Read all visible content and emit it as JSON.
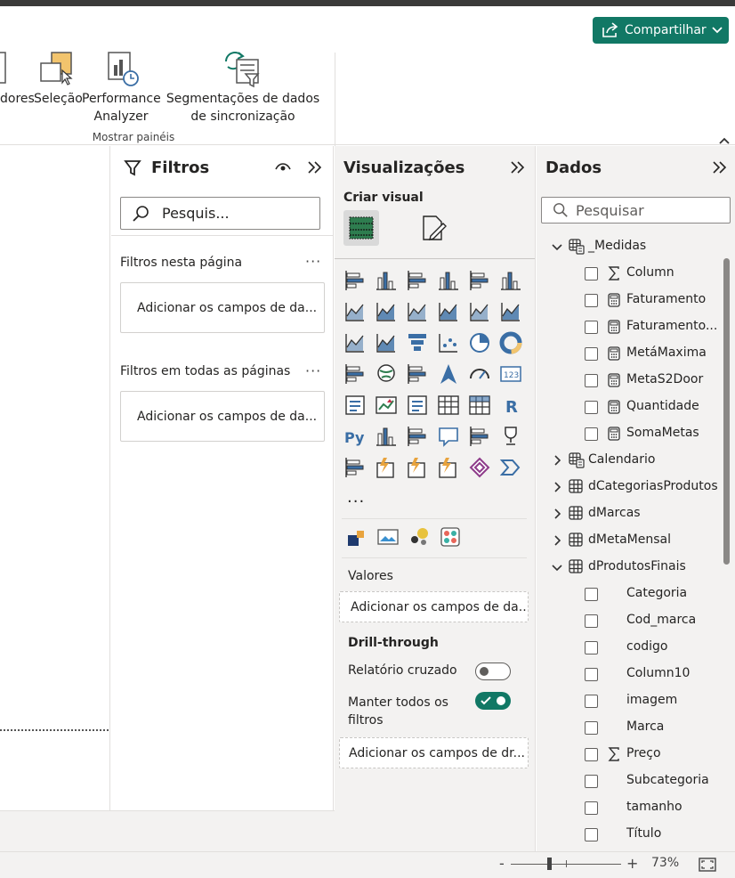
{
  "ribbon": {
    "share_label": "Compartilhar",
    "buttons": [
      {
        "label": "dores"
      },
      {
        "label": "Seleção"
      },
      {
        "label": "Performance Analyzer"
      },
      {
        "label": "Segmentações de dados de sincronização"
      }
    ],
    "group_label": "Mostrar painéis"
  },
  "filters": {
    "title": "Filtros",
    "search_placeholder": "Pesquis...",
    "page_section": "Filtros nesta página",
    "page_well": "Adicionar os campos de da...",
    "all_section": "Filtros em todas as páginas",
    "all_well": "Adicionar os campos de da..."
  },
  "viz": {
    "title": "Visualizações",
    "subtitle": "Criar visual",
    "more": "...",
    "values_label": "Valores",
    "values_well": "Adicionar os campos de da...",
    "drill_label": "Drill-through",
    "cross_report_label": "Relatório cruzado",
    "cross_report_on": false,
    "keep_filters_label_1": "Manter todos os",
    "keep_filters_label_2": "filtros",
    "keep_filters_on": true,
    "drill_well": "Adicionar os campos de dr...",
    "icons": [
      "stacked-bar-icon",
      "stacked-column-icon",
      "clustered-bar-icon",
      "clustered-column-icon",
      "100-stacked-bar-icon",
      "100-stacked-column-icon",
      "line-chart-icon",
      "area-chart-icon",
      "stacked-area-icon",
      "100-stacked-area-icon",
      "line-clustered-column-icon",
      "line-stacked-column-icon",
      "ribbon-chart-icon",
      "waterfall-icon",
      "funnel-icon",
      "scatter-icon",
      "pie-icon",
      "donut-icon",
      "treemap-icon",
      "map-icon",
      "filled-map-icon",
      "azure-map-icon",
      "gauge-icon",
      "card-icon",
      "multi-row-card-icon",
      "kpi-icon",
      "slicer-icon",
      "table-icon",
      "matrix-icon",
      "r-script-icon",
      "python-icon",
      "key-influencers-icon",
      "decomposition-tree-icon",
      "qa-icon",
      "narrative-icon",
      "goals-icon",
      "paginated-report-icon",
      "power-apps-icon",
      "power-automate-icon",
      "arcgis-icon",
      "shape-map-icon",
      "power-bi-app-icon"
    ],
    "extra_icons": [
      "custom-visual-icon",
      "image-visual-icon",
      "bubble-visual-icon",
      "palette-visual-icon"
    ]
  },
  "data_pane": {
    "title": "Dados",
    "search_placeholder": "Pesquisar",
    "tables": [
      {
        "name": "_Medidas",
        "expanded": true,
        "icon": "calc-table-icon",
        "fields": [
          {
            "name": "Column",
            "kind": "sigma"
          },
          {
            "name": "Faturamento",
            "kind": "calc"
          },
          {
            "name": "Faturamento...",
            "kind": "calc"
          },
          {
            "name": "MetáMaxima",
            "kind": "calc"
          },
          {
            "name": "MetaS2Door",
            "kind": "calc"
          },
          {
            "name": "Quantidade",
            "kind": "calc"
          },
          {
            "name": "SomaMetas",
            "kind": "calc"
          }
        ]
      },
      {
        "name": "Calendario",
        "expanded": false,
        "icon": "calc-table-icon",
        "fields": []
      },
      {
        "name": "dCategoriasProdutos",
        "expanded": false,
        "icon": "table-icon",
        "fields": []
      },
      {
        "name": "dMarcas",
        "expanded": false,
        "icon": "table-icon",
        "fields": []
      },
      {
        "name": "dMetaMensal",
        "expanded": false,
        "icon": "table-icon",
        "fields": []
      },
      {
        "name": "dProdutosFinais",
        "expanded": true,
        "icon": "table-icon",
        "fields": [
          {
            "name": "Categoria",
            "kind": "none"
          },
          {
            "name": "Cod_marca",
            "kind": "none"
          },
          {
            "name": "codigo",
            "kind": "none"
          },
          {
            "name": "Column10",
            "kind": "none"
          },
          {
            "name": "imagem",
            "kind": "none"
          },
          {
            "name": "Marca",
            "kind": "none"
          },
          {
            "name": "Preço",
            "kind": "sigma"
          },
          {
            "name": "Subcategoria",
            "kind": "none"
          },
          {
            "name": "tamanho",
            "kind": "none"
          },
          {
            "name": "Título",
            "kind": "none"
          }
        ]
      }
    ]
  },
  "status": {
    "zoom_minus": "-",
    "zoom_plus": "+",
    "zoom_level": "73%"
  },
  "colors": {
    "accent": "#117865",
    "pane_bg": "#f3f2f1",
    "icon_blue": "#3a6ea5"
  }
}
